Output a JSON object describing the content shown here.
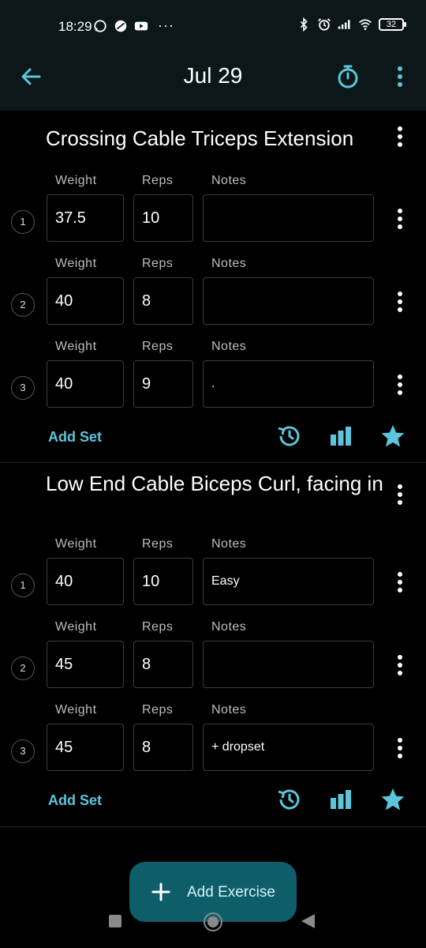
{
  "status_bar": {
    "time": "18:29",
    "left_icons": [
      "whatsapp-icon",
      "cloud-icon",
      "youtube-icon"
    ],
    "more": "···",
    "right_icons": [
      "bluetooth-icon",
      "alarm-icon",
      "signal-icon",
      "wifi-icon"
    ],
    "battery": "32"
  },
  "app_bar": {
    "title": "Jul 29",
    "accent": "#5cc5dc"
  },
  "labels": {
    "weight": "Weight",
    "reps": "Reps",
    "notes": "Notes",
    "add_set": "Add Set"
  },
  "exercises": [
    {
      "title": "Crossing Cable Triceps Extension",
      "sets": [
        {
          "number": "1",
          "weight": "37.5",
          "reps": "10",
          "notes": ""
        },
        {
          "number": "2",
          "weight": "40",
          "reps": "8",
          "notes": ""
        },
        {
          "number": "3",
          "weight": "40",
          "reps": "9",
          "notes": "."
        }
      ]
    },
    {
      "title": "Low End Cable Biceps Curl, facing in",
      "sets": [
        {
          "number": "1",
          "weight": "40",
          "reps": "10",
          "notes": "Easy"
        },
        {
          "number": "2",
          "weight": "45",
          "reps": "8",
          "notes": ""
        },
        {
          "number": "3",
          "weight": "45",
          "reps": "8",
          "notes": "+ dropset"
        }
      ]
    }
  ],
  "fab": {
    "label": "Add Exercise"
  }
}
